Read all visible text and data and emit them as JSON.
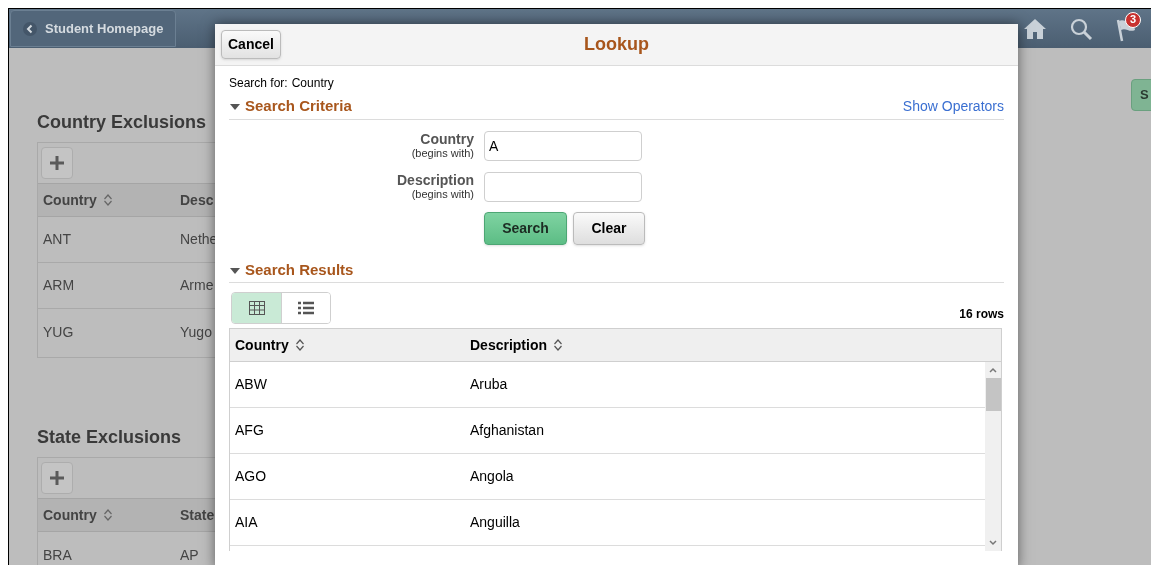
{
  "header": {
    "back_button": "Student Homepage",
    "notification_count": "3"
  },
  "background_page": {
    "sections": [
      {
        "title": "Country Exclusions",
        "columns": [
          "Country",
          "Desc"
        ],
        "rows": [
          [
            "ANT",
            "Nethe"
          ],
          [
            "ARM",
            "Arme"
          ],
          [
            "YUG",
            "Yugo"
          ]
        ]
      },
      {
        "title": "State Exclusions",
        "columns": [
          "Country",
          "State"
        ],
        "rows": [
          [
            "BRA",
            "AP"
          ]
        ]
      }
    ],
    "side_button": "S"
  },
  "lookup": {
    "cancel_button": "Cancel",
    "title": "Lookup",
    "search_for_label": "Search for:",
    "search_for_value": "Country",
    "criteria": {
      "title": "Search Criteria",
      "expanded": true,
      "show_operators": "Show Operators",
      "fields": [
        {
          "label": "Country",
          "hint": "(begins with)",
          "value": "A"
        },
        {
          "label": "Description",
          "hint": "(begins with)"
        }
      ],
      "buttons": [
        {
          "label": "Search",
          "kind": "primary"
        },
        {
          "label": "Clear",
          "kind": "secondary"
        }
      ]
    },
    "results": {
      "title": "Search Results",
      "expanded": true,
      "views": [
        {
          "kind": "grid",
          "selected": true
        },
        {
          "kind": "list",
          "selected": false
        }
      ],
      "row_count": "16 rows",
      "columns": [
        "Country",
        "Description"
      ],
      "rows": [
        [
          "ABW",
          "Aruba"
        ],
        [
          "AFG",
          "Afghanistan"
        ],
        [
          "AGO",
          "Angola"
        ],
        [
          "AIA",
          "Anguilla"
        ]
      ]
    }
  }
}
